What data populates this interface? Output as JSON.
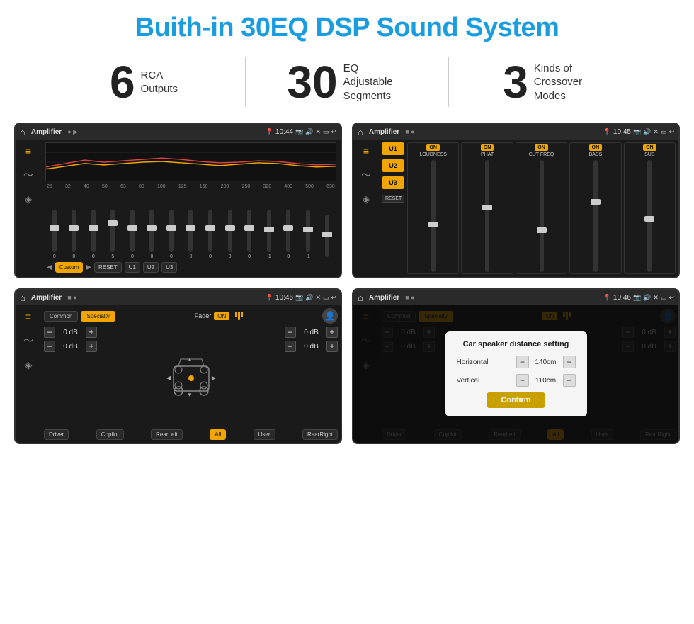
{
  "page": {
    "title": "Buith-in 30EQ DSP Sound System",
    "stats": [
      {
        "number": "6",
        "label": "RCA\nOutputs"
      },
      {
        "number": "30",
        "label": "EQ Adjustable\nSegments"
      },
      {
        "number": "3",
        "label": "Kinds of\nCrossover Modes"
      }
    ],
    "screens": [
      {
        "id": "eq-screen",
        "status_bar": {
          "title": "Amplifier",
          "time": "10:44"
        },
        "type": "eq"
      },
      {
        "id": "amp2-screen",
        "status_bar": {
          "title": "Amplifier",
          "time": "10:45"
        },
        "type": "amp2"
      },
      {
        "id": "cross-screen",
        "status_bar": {
          "title": "Amplifier",
          "time": "10:46"
        },
        "type": "crossover"
      },
      {
        "id": "dialog-screen",
        "status_bar": {
          "title": "Amplifier",
          "time": "10:46"
        },
        "type": "dialog"
      }
    ],
    "eq": {
      "frequencies": [
        "25",
        "32",
        "40",
        "50",
        "63",
        "80",
        "100",
        "125",
        "160",
        "200",
        "250",
        "320",
        "400",
        "500",
        "630"
      ],
      "values": [
        "0",
        "0",
        "0",
        "5",
        "0",
        "0",
        "0",
        "0",
        "0",
        "0",
        "0",
        "-1",
        "0",
        "-1",
        ""
      ],
      "preset": "Custom",
      "buttons": [
        "Custom",
        "RESET",
        "U1",
        "U2",
        "U3"
      ]
    },
    "amp2": {
      "presets": [
        "U1",
        "U2",
        "U3"
      ],
      "channels": [
        {
          "name": "LOUDNESS",
          "on": true
        },
        {
          "name": "PHAT",
          "on": true
        },
        {
          "name": "CUT FREQ",
          "on": true
        },
        {
          "name": "BASS",
          "on": true
        },
        {
          "name": "SUB",
          "on": true
        }
      ],
      "reset_label": "RESET"
    },
    "crossover": {
      "tabs": [
        "Common",
        "Specialty"
      ],
      "fader_label": "Fader",
      "fader_on": "ON",
      "db_values": [
        "0 dB",
        "0 dB",
        "0 dB",
        "0 dB"
      ],
      "buttons": [
        "Driver",
        "Copilot",
        "RearLeft",
        "All",
        "User",
        "RearRight"
      ]
    },
    "dialog": {
      "title": "Car speaker distance setting",
      "horizontal_label": "Horizontal",
      "horizontal_value": "140cm",
      "vertical_label": "Vertical",
      "vertical_value": "110cm",
      "confirm_label": "Confirm",
      "db_values_right": [
        "0 dB",
        "0 dB"
      ],
      "buttons": [
        "Driver",
        "Copilot",
        "RearLeft",
        "All",
        "User",
        "RearRight"
      ]
    }
  }
}
